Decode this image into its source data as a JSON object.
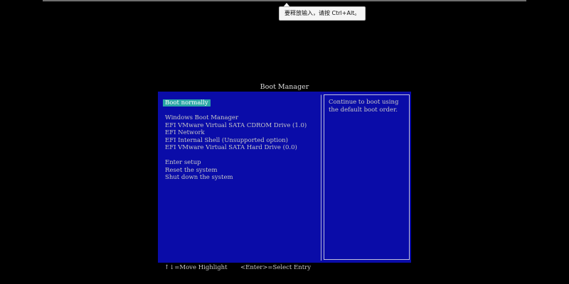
{
  "tooltip": {
    "text": "要释放输入，请按 Ctrl+Alt。"
  },
  "bios": {
    "title": "Boot Manager",
    "menu": {
      "selected": "Boot normally",
      "boot_options": [
        "Windows Boot Manager",
        "EFI VMware Virtual SATA CDROM Drive (1.0)",
        "EFI Network",
        "EFI Internal Shell (Unsupported option)",
        "EFI VMware Virtual SATA Hard Drive (0.0)"
      ],
      "system_options": [
        "Enter setup",
        "Reset the system",
        "Shut down the system"
      ]
    },
    "help": {
      "line1": "Continue to boot using",
      "line2": "the default boot order."
    },
    "status": {
      "move_hint": "↑↓=Move Highlight",
      "select_hint": "<Enter>=Select Entry"
    }
  },
  "colors": {
    "screen_background": "#000000",
    "bios_blue": "#0a0ca8",
    "highlight": "#2aa6a6",
    "text": "#c8c8c8"
  }
}
